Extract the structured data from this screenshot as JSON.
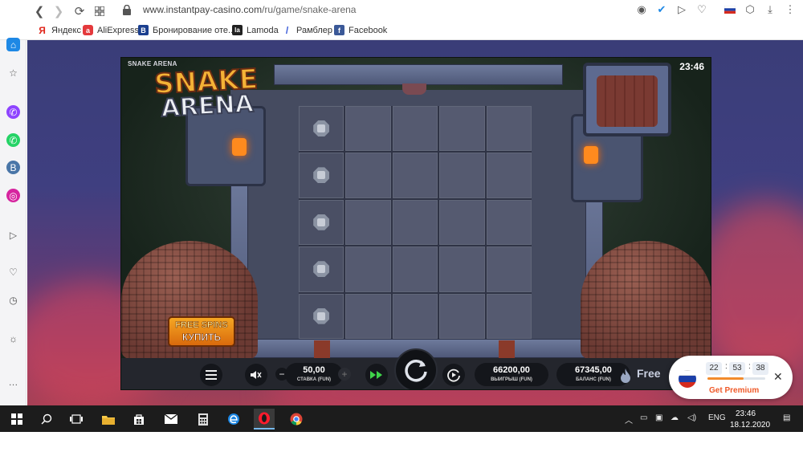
{
  "browser": {
    "url_host": "www.instantpay-casino.com",
    "url_path": "/ru/game/snake-arena",
    "bookmarks": [
      {
        "label": "Яндекс",
        "icon": "yandex-icon",
        "color": "#ffffff",
        "glyph": "Я",
        "glyph_color": "#e0261b"
      },
      {
        "label": "AliExpress",
        "icon": "aliexpress-icon",
        "color": "#e4393c",
        "glyph": "a",
        "glyph_color": "#ffffff"
      },
      {
        "label": "Бронирование оте...",
        "icon": "booking-icon",
        "color": "#1b3f8f",
        "glyph": "B",
        "glyph_color": "#ffffff"
      },
      {
        "label": "Lamoda",
        "icon": "lamoda-icon",
        "color": "#222222",
        "glyph": "la",
        "glyph_color": "#ffffff"
      },
      {
        "label": "Рамблер",
        "icon": "rambler-icon",
        "color": "#ffffff",
        "glyph": "/",
        "glyph_color": "#3a5bd9"
      },
      {
        "label": "Facebook",
        "icon": "facebook-icon",
        "color": "#3b5998",
        "glyph": "f",
        "glyph_color": "#ffffff"
      }
    ]
  },
  "game": {
    "title": "SNAKE ARENA",
    "clock": "23:46",
    "logo_line1": "SNAKE",
    "logo_line2": "ARENA",
    "free_spins_line1": "FREE SPINS",
    "free_spins_line2": "КУПИТЬ",
    "bet_value": "50,00",
    "bet_caption": "СТАВКА (FUN)",
    "win_value": "66200,00",
    "win_caption": "ВЫИГРЫШ (FUN)",
    "balance_value": "67345,00",
    "balance_caption": "БАЛАНС (FUN)",
    "free_label": "Free"
  },
  "premium": {
    "hours": "22",
    "minutes": "53",
    "seconds": "38",
    "cta": "Get Premium",
    "progress": 0.62
  },
  "taskbar": {
    "lang": "ENG",
    "time": "23:46",
    "date": "18.12.2020"
  }
}
